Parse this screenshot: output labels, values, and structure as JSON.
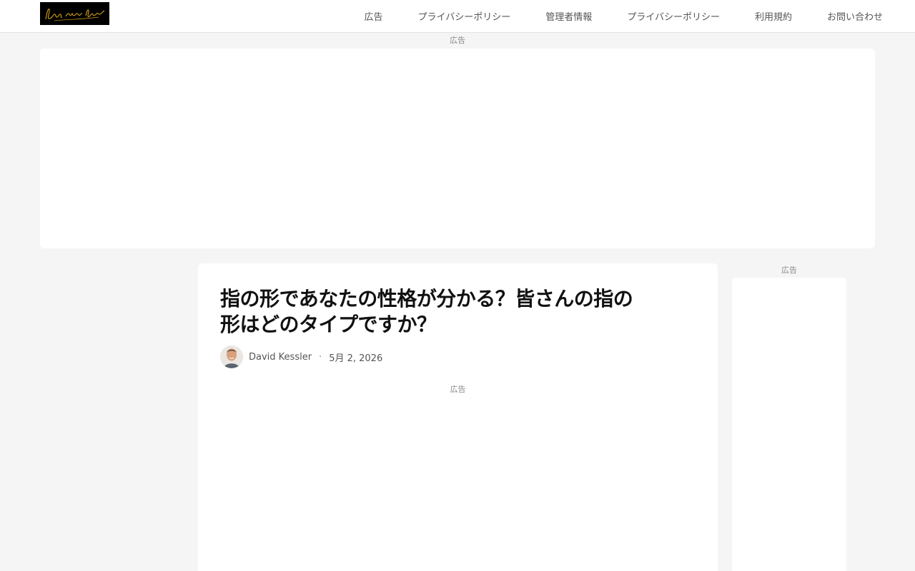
{
  "header": {
    "logo_text": "Luv your lifestyle",
    "nav": [
      {
        "label": "広告"
      },
      {
        "label": "プライバシーポリシー"
      },
      {
        "label": "管理者情報"
      },
      {
        "label": "プライバシーポリシー"
      },
      {
        "label": "利用規約"
      },
      {
        "label": "お問い合わせ"
      }
    ]
  },
  "ads": {
    "top_label": "広告",
    "inline_label": "広告",
    "sidebar_label": "広告"
  },
  "article": {
    "title_line1": "指の形であなたの性格が分かる？皆さんの指の",
    "title_line2": "形はどのタイプですか？",
    "author": "David Kessler",
    "separator": "·",
    "date": "5月 2, 2026"
  },
  "colors": {
    "background": "#f5f5f5",
    "card": "#ffffff",
    "logo_bg": "#000000",
    "logo_script": "#d4a017"
  }
}
